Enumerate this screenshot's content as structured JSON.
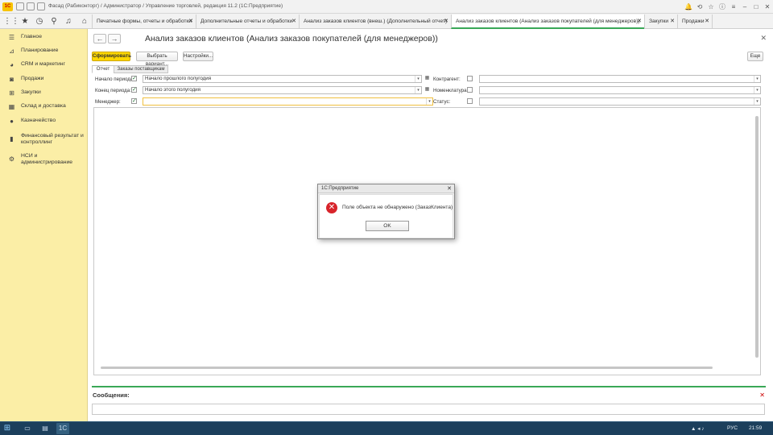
{
  "window": {
    "title": "Фасад (Рабиконторг) / Администратор / Управление торговлей, редакция 11.2  (1С:Предприятие)",
    "logo": "1С"
  },
  "tabs": [
    {
      "label": "Печатные формы, отчеты и обработки"
    },
    {
      "label": "Дополнительные отчеты и обработки"
    },
    {
      "label": "Анализ заказов клиентов (внеш.) (Дополнительный отчет)"
    },
    {
      "label": "Анализ заказов клиентов (Анализ заказов покупателей (для менеджеров))"
    },
    {
      "label": "Закупки"
    },
    {
      "label": "Продажи"
    }
  ],
  "sidebar": {
    "items": [
      {
        "label": "Главное",
        "icon": "list-icon"
      },
      {
        "label": "Планирование",
        "icon": "chart-icon"
      },
      {
        "label": "CRM и маркетинг",
        "icon": "pie-icon"
      },
      {
        "label": "Продажи",
        "icon": "bag-icon"
      },
      {
        "label": "Закупки",
        "icon": "cart-icon"
      },
      {
        "label": "Склад и доставка",
        "icon": "grid-icon"
      },
      {
        "label": "Казначейство",
        "icon": "coin-icon"
      },
      {
        "label": "Финансовый результат и контроллинг",
        "icon": "bars-icon"
      },
      {
        "label": "НСИ и администрирование",
        "icon": "gear-icon"
      }
    ]
  },
  "main": {
    "title": "Анализ заказов клиентов (Анализ заказов покупателей (для менеджеров))",
    "buttons": {
      "generate": "Сформировать",
      "choose_variant": "Выбрать вариант...",
      "settings": "Настройки...",
      "more": "Еще"
    },
    "subtabs": [
      "Отчет",
      "Заказы поставщикам"
    ],
    "filters": {
      "period_start": {
        "label": "Начало периода:",
        "value": "Начало прошлого полугодия",
        "checked": true
      },
      "period_end": {
        "label": "Конец периода:",
        "value": "Начало этого полугодия",
        "checked": true
      },
      "manager": {
        "label": "Менеджер:",
        "value": "",
        "checked": true
      },
      "counterparty": {
        "label": "Контрагент:",
        "value": "",
        "checked": false
      },
      "nomenclature": {
        "label": "Номенклатура:",
        "value": "",
        "checked": false
      },
      "status": {
        "label": "Статус:",
        "value": "",
        "checked": false
      }
    },
    "messages_label": "Сообщения:"
  },
  "dialog": {
    "title": "1С:Предприятие",
    "message": "Поле объекта не обнаружено (ЗаказКлиента)",
    "ok": "OK"
  },
  "taskbar": {
    "lang": "РУС",
    "time": "21:59"
  },
  "colors": {
    "sidebar": "#fbeea6",
    "primary_button": "#fbd600",
    "accent_green": "#3aa857",
    "error": "#d8242b"
  }
}
